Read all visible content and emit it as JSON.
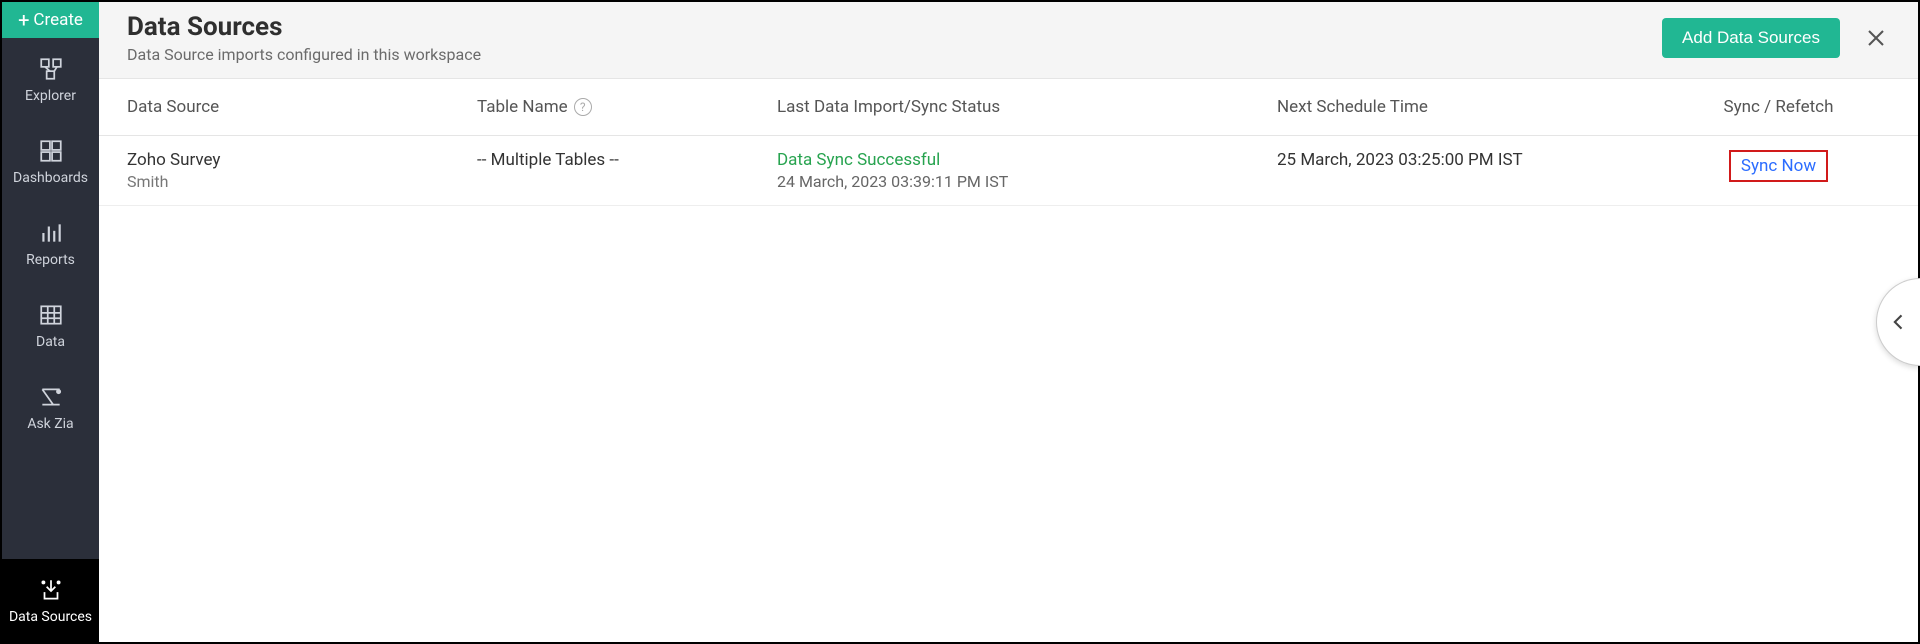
{
  "sidebar": {
    "create_label": "Create",
    "items": [
      {
        "label": "Explorer"
      },
      {
        "label": "Dashboards"
      },
      {
        "label": "Reports"
      },
      {
        "label": "Data"
      },
      {
        "label": "Ask Zia"
      },
      {
        "label": "Data Sources"
      }
    ]
  },
  "header": {
    "title": "Data Sources",
    "subtitle": "Data Source imports configured in this workspace",
    "add_label": "Add Data Sources"
  },
  "table": {
    "columns": {
      "data_source": "Data Source",
      "table_name": "Table Name",
      "last_status": "Last Data Import/Sync Status",
      "next_schedule": "Next Schedule Time",
      "sync_refetch": "Sync / Refetch"
    },
    "rows": [
      {
        "source_name": "Zoho Survey",
        "source_sub": "Smith",
        "table_name": "-- Multiple Tables --",
        "status_text": "Data Sync Successful",
        "status_time": "24 March, 2023 03:39:11 PM IST",
        "next_schedule": "25 March, 2023 03:25:00 PM IST",
        "sync_action": "Sync Now"
      }
    ]
  }
}
